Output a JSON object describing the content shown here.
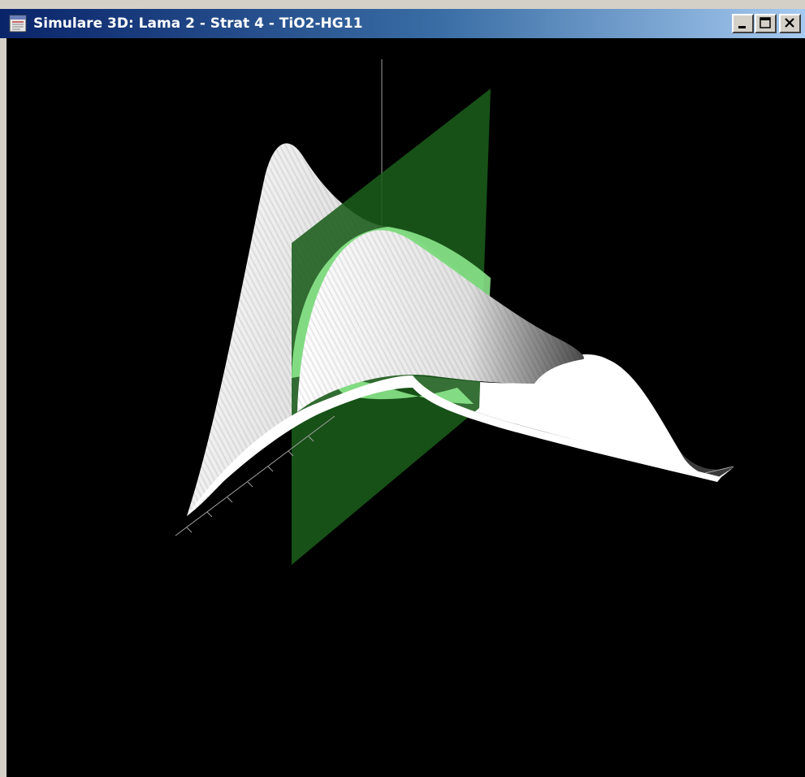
{
  "window": {
    "title": "Simulare 3D: Lama 2 - Strat 4 - TiO2-HG11",
    "icon": "application-window-icon",
    "controls": {
      "minimize": "minimize-icon",
      "maximize": "maximize-icon",
      "close": "close-icon"
    }
  },
  "scene": {
    "background_color": "#000000",
    "surface_color": "#ffffff",
    "surface_shade_color": "#404040",
    "plane_color": "#1a5c1a",
    "plane_highlight_color": "#90ee90",
    "axis_color": "#a0a0a0"
  }
}
